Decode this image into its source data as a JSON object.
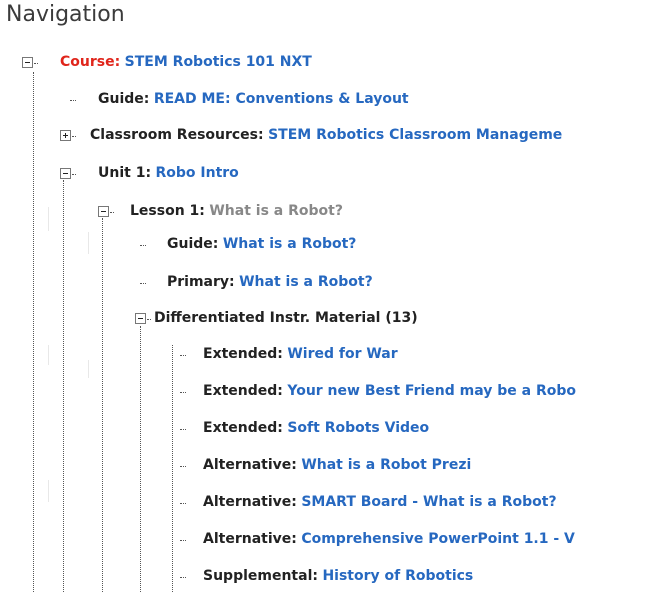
{
  "header": {
    "title": "Navigation"
  },
  "colors": {
    "link": "#2668c0",
    "course_label": "#e0251b",
    "muted": "#888888",
    "text": "#222222"
  },
  "icons": {
    "expanded": "minus-box-icon",
    "collapsed": "plus-box-icon"
  },
  "tree": {
    "course": {
      "label": "Course:",
      "value": "STEM Robotics 101 NXT",
      "expanded": true
    },
    "guide_conventions": {
      "label": "Guide:",
      "value": "READ ME: Conventions & Layout"
    },
    "classroom_resources": {
      "label": "Classroom Resources:",
      "value": "STEM Robotics Classroom Manageme",
      "expanded": false
    },
    "unit1": {
      "label": "Unit 1:",
      "value": "Robo Intro",
      "expanded": true
    },
    "lesson1": {
      "label": "Lesson 1:",
      "value": "What is a Robot?",
      "expanded": true
    },
    "lesson_guide": {
      "label": "Guide:",
      "value": "What is a Robot?"
    },
    "lesson_primary": {
      "label": "Primary:",
      "value": "What is a Robot?"
    },
    "differentiated": {
      "label": "Differentiated Instr. Material (13)",
      "expanded": true
    },
    "materials": [
      {
        "label": "Extended:",
        "value": "Wired for War"
      },
      {
        "label": "Extended:",
        "value": "Your new Best Friend may be a Robo"
      },
      {
        "label": "Extended:",
        "value": "Soft Robots Video"
      },
      {
        "label": "Alternative:",
        "value": "What is a Robot Prezi"
      },
      {
        "label": "Alternative:",
        "value": "SMART Board - What is a Robot?"
      },
      {
        "label": "Alternative:",
        "value": "Comprehensive PowerPoint 1.1 - V"
      },
      {
        "label": "Supplemental:",
        "value": "History of Robotics"
      }
    ]
  }
}
